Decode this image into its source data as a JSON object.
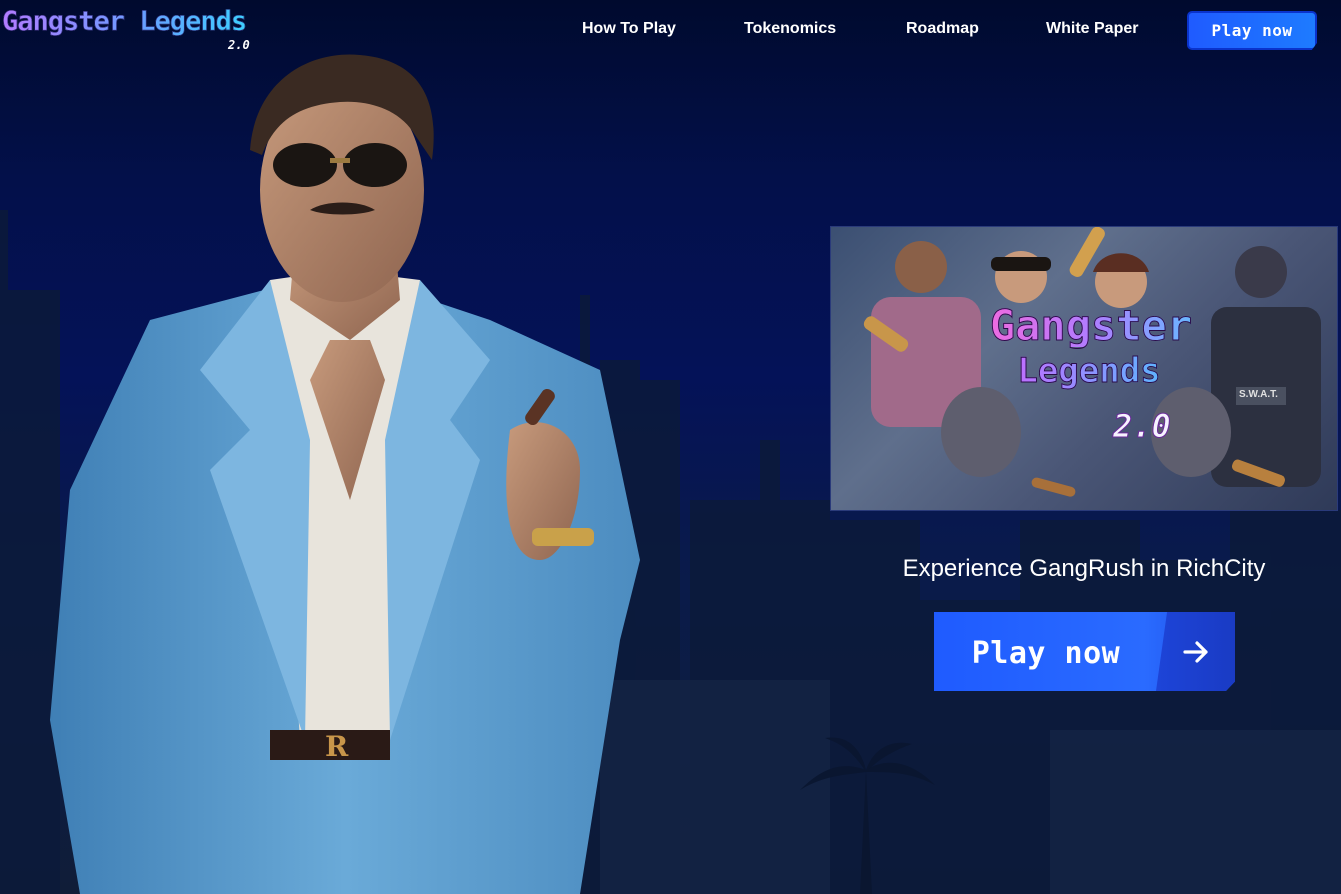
{
  "header": {
    "logo_text": "Gangster Legends",
    "logo_version": "2.0",
    "nav": {
      "how_to_play": "How To Play",
      "tokenomics": "Tokenomics",
      "roadmap": "Roadmap",
      "white_paper": "White Paper"
    },
    "play_button": "Play now"
  },
  "hero": {
    "promo_image": {
      "title": "Gangster",
      "subtitle": "Legends",
      "version": "2.0",
      "badge_text": "S.W.A.T."
    },
    "tagline": "Experience GangRush in RichCity",
    "play_button": "Play now",
    "character_belt_letter": "R"
  },
  "icons": {
    "arrow": "arrow-right-icon"
  },
  "colors": {
    "accent_blue": "#1f5bff",
    "background_navy": "#041258",
    "jacket_blue": "#5f9fd0"
  }
}
